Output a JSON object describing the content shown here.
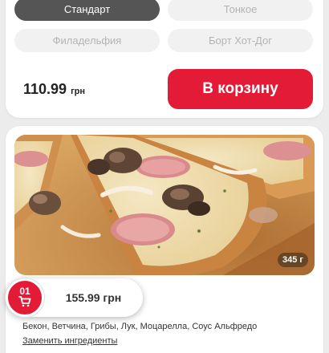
{
  "variants": {
    "crust": [
      {
        "label": "Стандарт",
        "active": true
      },
      {
        "label": "Тонкое",
        "active": false
      }
    ],
    "style": [
      {
        "label": "Филадельфия",
        "active": false
      },
      {
        "label": "Борт Хот-Дог",
        "active": false
      }
    ]
  },
  "top_product": {
    "price": "110.99",
    "currency": "грн",
    "add_to_cart_label": "В корзину"
  },
  "product": {
    "weight": "345 г",
    "ingredients": "Бекон, Ветчина, Грибы, Лук, Моцарелла, Соус Альфредо",
    "change_ingredients_label": "Заменить ингредиенты"
  },
  "cart_float": {
    "count": "01",
    "total": "155.99 грн"
  },
  "colors": {
    "accent": "#e31b37",
    "active_pill": "#555555",
    "inactive_pill": "#f1f1f1"
  }
}
